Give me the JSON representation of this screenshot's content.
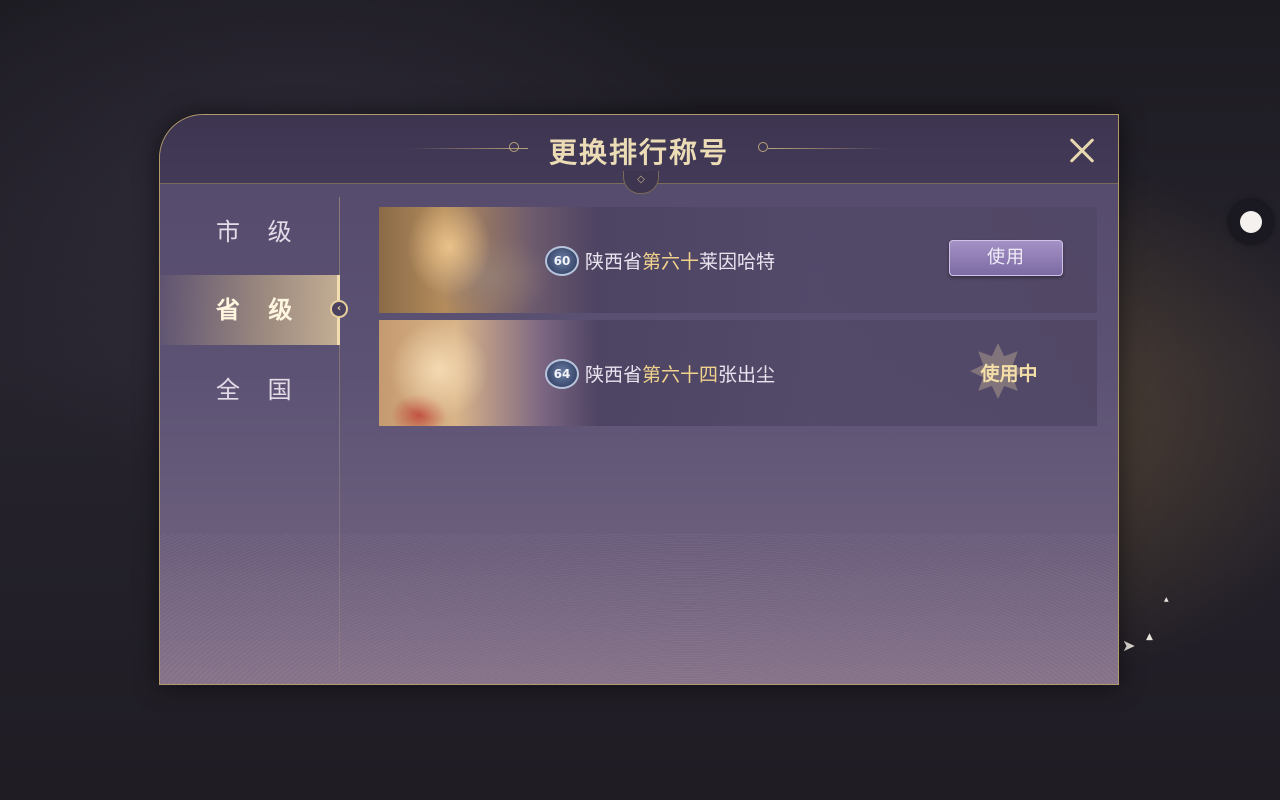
{
  "dialog": {
    "title": "更换排行称号",
    "close_icon": "close-icon"
  },
  "sidebar": {
    "items": [
      {
        "label": "市 级",
        "active": false
      },
      {
        "label": "省 级",
        "active": true
      },
      {
        "label": "全 国",
        "active": false
      }
    ]
  },
  "titles": [
    {
      "rank": "60",
      "prefix": "陕西省",
      "highlight": "第六十",
      "hero": "莱因哈特",
      "action": "使用",
      "state": "available"
    },
    {
      "rank": "64",
      "prefix": "陕西省",
      "highlight": "第六十四",
      "hero": "张出尘",
      "action": "使用中",
      "state": "in-use"
    }
  ],
  "colors": {
    "accent_gold": "#ecdcb5",
    "highlight_gold": "#f0d28c",
    "panel_purple": "#5c5274",
    "button_purple": "#8f7db4"
  }
}
